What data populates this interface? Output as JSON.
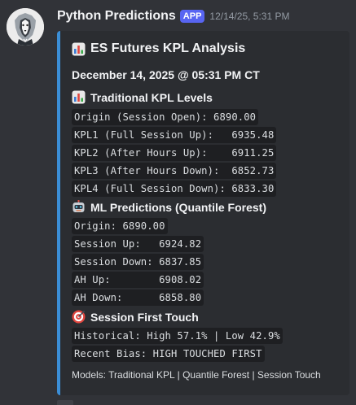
{
  "message": {
    "username": "Python Predictions",
    "badge": "APP",
    "timestamp": "12/14/25, 5:31 PM"
  },
  "colors": {
    "background": "#313338",
    "embed_background": "#2b2d31",
    "embed_border": "#3b8ed6",
    "app_badge": "#5865f2",
    "code_background": "#1e1f22"
  },
  "embed": {
    "title": "ES Futures KPL Analysis",
    "title_icon": "bar-chart-icon",
    "date": "December 14, 2025 @ 05:31 PM CT",
    "sections": {
      "traditional": {
        "title": "Traditional KPL Levels",
        "icon": "bar-chart-icon",
        "lines": [
          "Origin (Session Open): 6890.00",
          "KPL1 (Full Session Up):   6935.48",
          "KPL2 (After Hours Up):    6911.25",
          "KPL3 (After Hours Down):  6852.73",
          "KPL4 (Full Session Down): 6833.30"
        ]
      },
      "ml": {
        "title": "ML Predictions (Quantile Forest)",
        "icon": "robot-icon",
        "lines": [
          "Origin: 6890.00",
          "Session Up:   6924.82",
          "Session Down: 6837.85",
          "AH Up:        6908.02",
          "AH Down:      6858.80"
        ]
      },
      "touch": {
        "title": "Session First Touch",
        "icon": "target-icon",
        "lines": [
          "Historical: High 57.1% | Low 42.9%",
          "Recent Bias: HIGH TOUCHED FIRST"
        ]
      }
    },
    "footer": "Models: Traditional KPL | Quantile Forest | Session Touch"
  }
}
